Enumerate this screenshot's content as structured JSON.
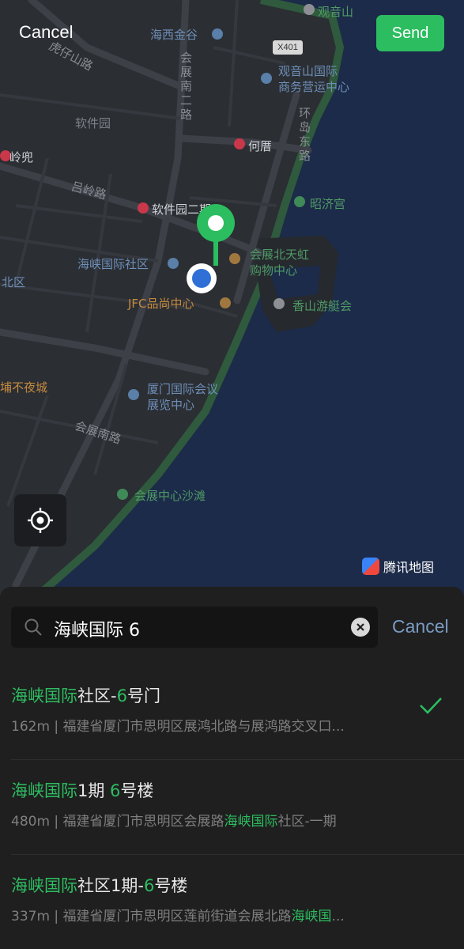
{
  "header": {
    "cancel_label": "Cancel",
    "send_label": "Send"
  },
  "map": {
    "brand": "腾讯地图",
    "road_sign": "X401",
    "labels": {
      "haixi_jingu": "海西金谷",
      "guanyinshan_top": "观音山",
      "liuwu_road": "虎仔山路",
      "huizhan_nan_road": "会展南二路",
      "guanyinshan_center": "观音山国际\n商务营运中心",
      "software_park": "软件园",
      "lingdou": "岭兜",
      "hecuo": "何厝",
      "huandao_east": "环岛东路",
      "lvling_road": "吕岭路",
      "software_park_2": "软件园二期",
      "shengji_palace": "昭济宫",
      "haixia_community": "海峡国际社区",
      "huizhan_bei_tianhong": "会展北天虹\n购物中心",
      "north_district": "北区",
      "jfc": "JFC品尚中心",
      "xiangshan_yacht": "香山游艇会",
      "night_market": "埔不夜城",
      "xiamen_convention": "厦门国际会议\n展览中心",
      "huizhan_nan_lu": "会展南路",
      "beach": "会展中心沙滩"
    }
  },
  "search": {
    "query": "海峡国际 6",
    "cancel_label": "Cancel"
  },
  "results": [
    {
      "title_hl1": "海峡国际",
      "title_mid": "社区-",
      "title_hl2": "6",
      "title_end": "号门",
      "sub_pre": "162m | 福建省厦门市思明区展鸿北路与展鸿路交叉口...",
      "sub_hl": "",
      "sub_post": "",
      "selected": true
    },
    {
      "title_hl1": "海峡国际",
      "title_mid": "1期 ",
      "title_hl2": "6",
      "title_end": "号楼",
      "sub_pre": "480m | 福建省厦门市思明区会展路",
      "sub_hl": "海峡国际",
      "sub_post": "社区-一期",
      "selected": false
    },
    {
      "title_hl1": "海峡国际",
      "title_mid": "社区1期-",
      "title_hl2": "6",
      "title_end": "号楼",
      "sub_pre": "337m | 福建省厦门市思明区莲前街道会展北路",
      "sub_hl": "海峡国",
      "sub_post": "...",
      "selected": false
    }
  ],
  "colors": {
    "accent": "#2bbd5f",
    "highlight": "#2dbd61",
    "link": "#7a9bc2",
    "water": "#1c2b49"
  }
}
